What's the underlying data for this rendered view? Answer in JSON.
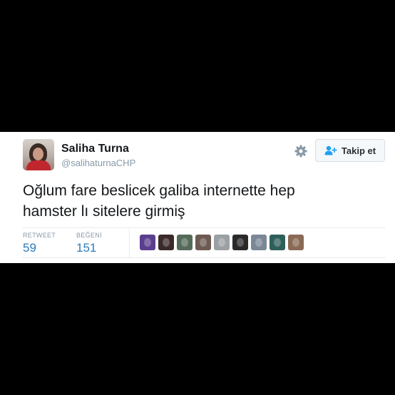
{
  "tweet": {
    "author_name": "Saliha Turna",
    "author_handle": "@salihaturnaCHP",
    "text": "Oğlum fare beslicek galiba internette hep\nhamster lı sitelere girmiş",
    "follow_label": "Takip et",
    "retweet_label": "RETWEET",
    "retweet_count": "59",
    "like_label": "BEĞENİ",
    "like_count": "151"
  },
  "icons": {
    "settings": "gear-icon",
    "follow": "add-person-icon"
  },
  "colors": {
    "background": "#000000",
    "card": "#ffffff",
    "stat_value": "#2b7bb9",
    "muted": "#8899a6",
    "follow_icon": "#1da1f2"
  },
  "likers": [
    {
      "name": "liker-avatar-1",
      "color": "#5b3f8f"
    },
    {
      "name": "liker-avatar-2",
      "color": "#3b2a2a"
    },
    {
      "name": "liker-avatar-3",
      "color": "#556b5a"
    },
    {
      "name": "liker-avatar-4",
      "color": "#6d5a52"
    },
    {
      "name": "liker-avatar-5",
      "color": "#9aa0a4"
    },
    {
      "name": "liker-avatar-6",
      "color": "#2a2a2a"
    },
    {
      "name": "liker-avatar-7",
      "color": "#7a8795"
    },
    {
      "name": "liker-avatar-8",
      "color": "#2f5f5a"
    },
    {
      "name": "liker-avatar-9",
      "color": "#8a6a55"
    }
  ]
}
